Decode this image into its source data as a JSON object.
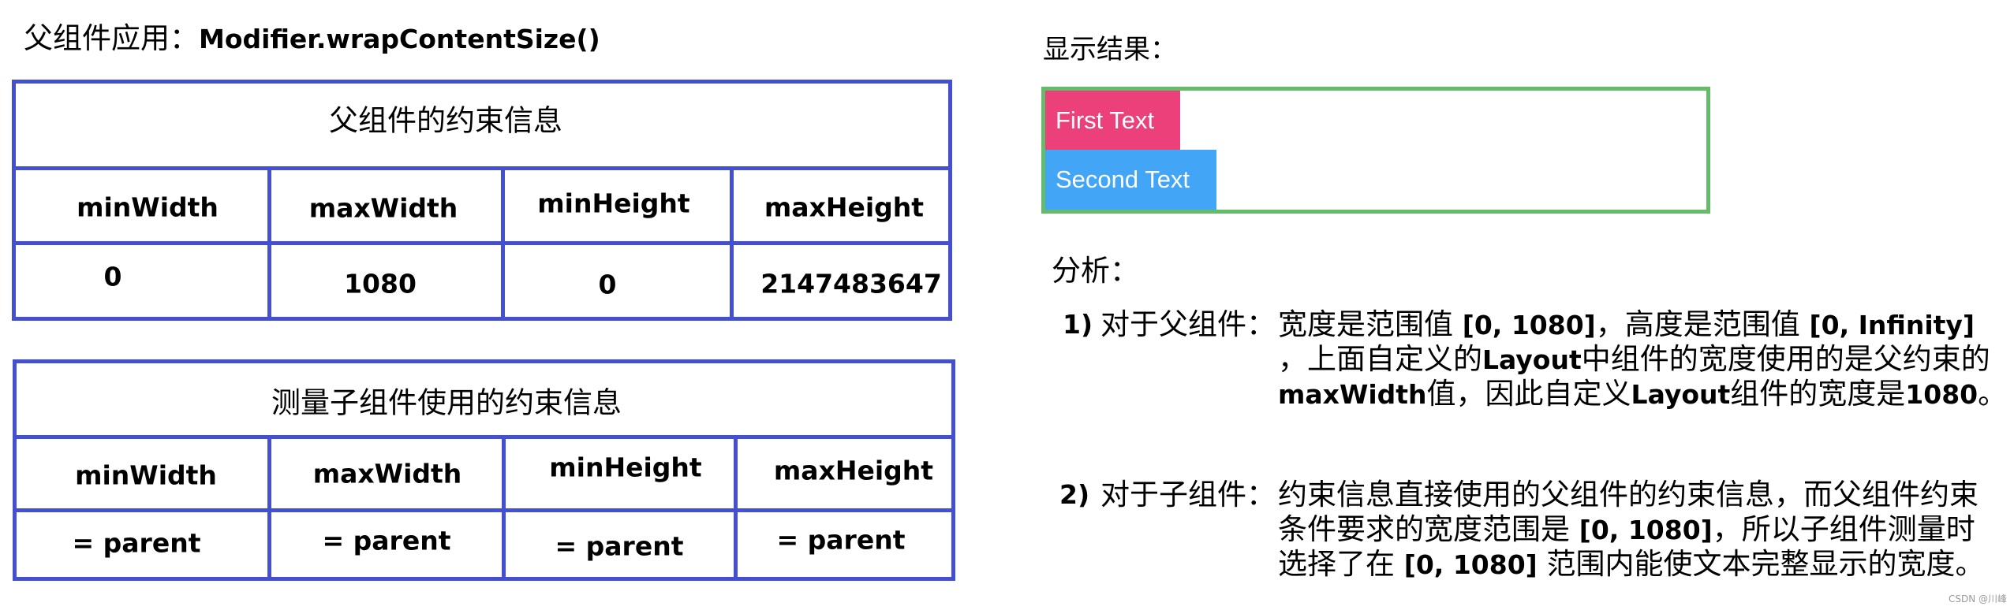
{
  "title": {
    "prefix": "父组件应用：",
    "code": "Modifier.wrapContentSize()"
  },
  "parent_constraints_table": {
    "title": "父组件的约束信息",
    "columns": [
      "minWidth",
      "maxWidth",
      "minHeight",
      "maxHeight"
    ],
    "rows": [
      [
        "0",
        "1080",
        "0",
        "2147483647"
      ]
    ]
  },
  "child_constraints_table": {
    "title": "测量子组件使用的约束信息",
    "columns": [
      "minWidth",
      "maxWidth",
      "minHeight",
      "maxHeight"
    ],
    "rows": [
      [
        "= parent",
        "= parent",
        "= parent",
        "= parent"
      ]
    ]
  },
  "result": {
    "label": "显示结果：",
    "container_border_color": "#66BB6A",
    "items": [
      {
        "text": "First Text",
        "color": "#EC407A"
      },
      {
        "text": "Second Text",
        "color": "#42A5F5"
      }
    ]
  },
  "analysis": {
    "label": "分析：",
    "items": [
      {
        "number": "1)",
        "subject": "对于父组件：",
        "lines": [
          [
            {
              "t": "宽度是范围值 ",
              "b": false
            },
            {
              "t": "[0, 1080]",
              "b": true
            },
            {
              "t": "，高度是范围值 ",
              "b": false
            },
            {
              "t": "[0, Infinity]",
              "b": true
            }
          ],
          [
            {
              "t": "，上面自定义的",
              "b": false
            },
            {
              "t": "Layout",
              "b": true
            },
            {
              "t": "中组件的宽度使用的是父约束的",
              "b": false
            }
          ],
          [
            {
              "t": "maxWidth",
              "b": true
            },
            {
              "t": "值，因此自定义",
              "b": false
            },
            {
              "t": "Layout",
              "b": true
            },
            {
              "t": "组件的宽度是",
              "b": false
            },
            {
              "t": "1080",
              "b": true
            },
            {
              "t": "。",
              "b": false
            }
          ]
        ]
      },
      {
        "number": "2)",
        "subject": "对于子组件：",
        "lines": [
          [
            {
              "t": "约束信息直接使用的父组件的约束信息，而父组件约束",
              "b": false
            }
          ],
          [
            {
              "t": "条件要求的宽度范围是 ",
              "b": false
            },
            {
              "t": "[0, 1080]",
              "b": true
            },
            {
              "t": "，所以子组件测量时",
              "b": false
            }
          ],
          [
            {
              "t": "选择了在 ",
              "b": false
            },
            {
              "t": "[0, 1080]",
              "b": true
            },
            {
              "t": " 范围内能使文本完整显示的宽度。",
              "b": false
            }
          ]
        ]
      }
    ]
  },
  "colors": {
    "table_border": "#4350D0"
  },
  "watermark": "CSDN @川峰"
}
